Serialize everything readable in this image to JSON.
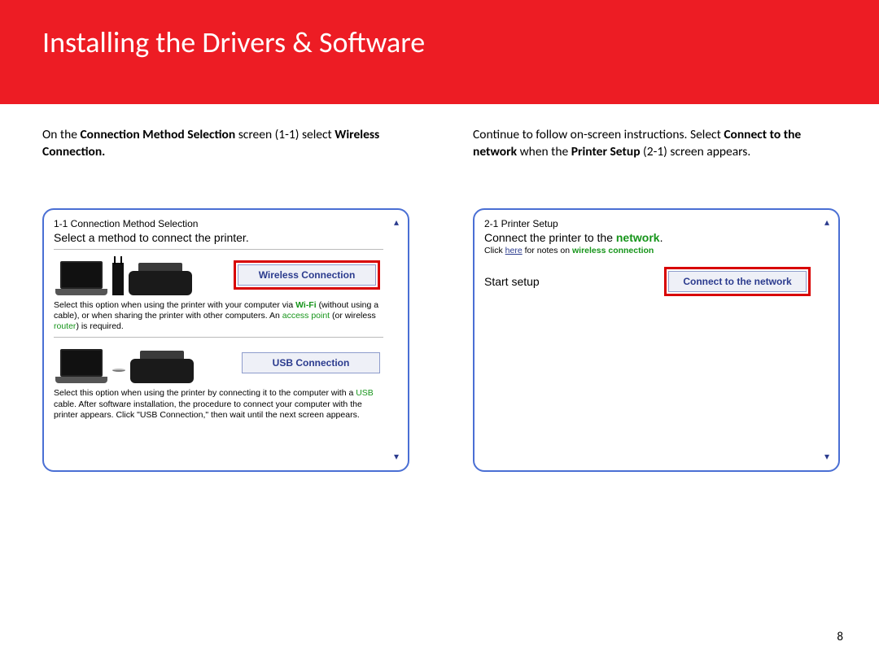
{
  "header": {
    "title": "Installing  the Drivers & Software"
  },
  "left": {
    "intro_html": "On the <b>Connection Method Selection</b> screen (1-1) select <b>Wireless Connection.</b>",
    "dialog_title": "1-1 Connection Method Selection",
    "dialog_sub": "Select a method to connect the printer.",
    "wireless_btn": "Wireless Connection",
    "wireless_desc_html": "Select this option when using the printer with your computer via <span class='kw-green'>Wi-Fi</span> (without using a cable), or when sharing the printer with other computers. An <span class='kw-link'>access point</span> (or wireless <span class='kw-link'>router</span>) is required.",
    "usb_btn": "USB Connection",
    "usb_desc_html": "Select this option when using the printer by connecting it to the computer with a <span class='kw-link'>USB</span> cable. After software installation, the procedure to connect your computer with the printer appears. Click \"USB Connection,\" then wait until the next screen appears."
  },
  "right": {
    "intro_html": "Continue to follow on-screen instructions. Select <b>Connect to the network</b> when the <b>Printer Setup</b> (2-1) screen appears.",
    "dialog_title": "2-1 Printer Setup",
    "connect_html": "Connect the printer to the <span class='kw-green'>network</span>.",
    "notes_html": "Click <a href='#'>here</a> for notes on <span class='kw-green'>wireless connection</span>",
    "start_label": "Start setup",
    "connect_btn": "Connect to the network"
  },
  "page_number": "8"
}
